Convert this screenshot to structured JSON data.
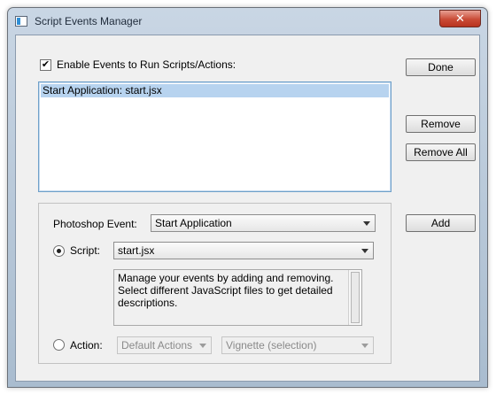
{
  "window": {
    "title": "Script Events Manager",
    "close_glyph": "✕"
  },
  "enable_events": {
    "label": "Enable Events to Run Scripts/Actions:",
    "checked": true
  },
  "events_list": {
    "items": [
      "Start Application: start.jsx"
    ],
    "selected_index": 0
  },
  "buttons": {
    "done": "Done",
    "remove": "Remove",
    "remove_all": "Remove All",
    "add": "Add"
  },
  "photoshop_event": {
    "label": "Photoshop Event:",
    "value": "Start Application"
  },
  "script": {
    "label": "Script:",
    "selected": true,
    "value": "start.jsx",
    "description": "Manage your events by adding and removing. Select different JavaScript files to get detailed descriptions."
  },
  "action": {
    "label": "Action:",
    "selected": false,
    "set_value": "Default Actions",
    "action_value": "Vignette (selection)"
  },
  "colors": {
    "selection": "#b7d3ef",
    "dialog_bg": "#f0f0f0",
    "close_button": "#c94b36"
  }
}
